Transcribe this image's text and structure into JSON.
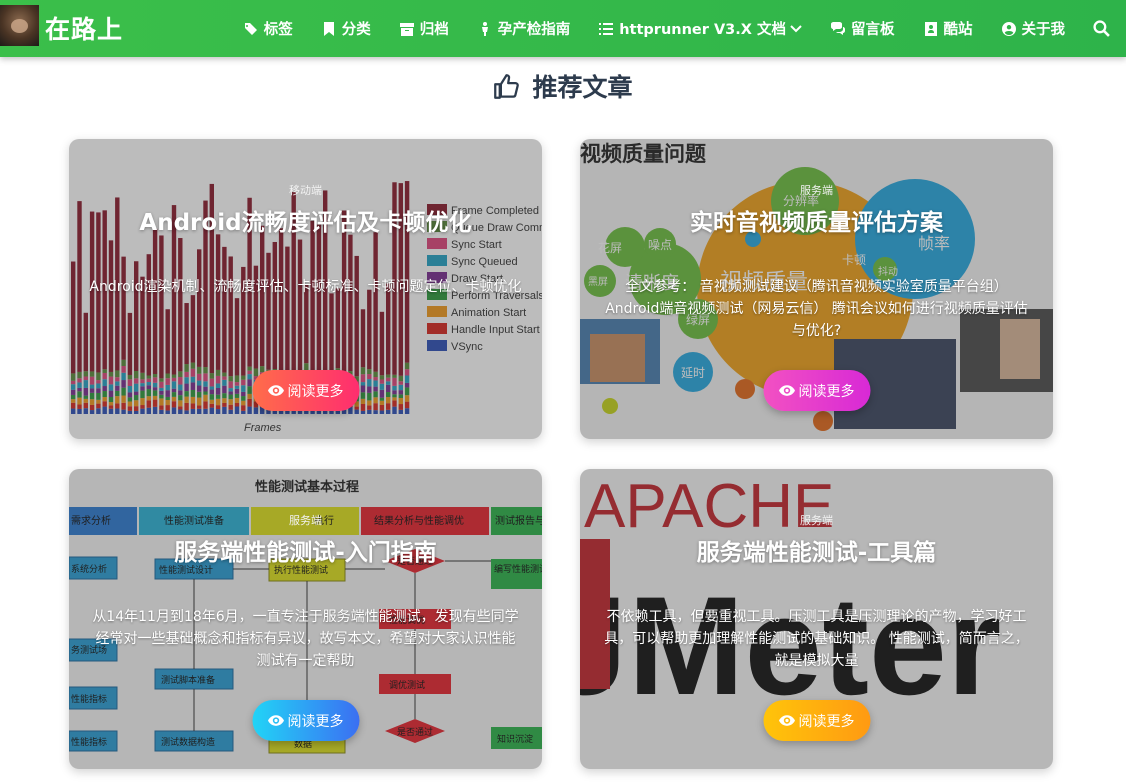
{
  "nav": {
    "brand": "在路上",
    "items": [
      {
        "icon": "tags-icon",
        "label": "标签"
      },
      {
        "icon": "bookmark-icon",
        "label": "分类"
      },
      {
        "icon": "archive-icon",
        "label": "归档"
      },
      {
        "icon": "person-icon",
        "label": "孕产检指南"
      },
      {
        "icon": "list-icon",
        "label": "httprunner V3.X 文档"
      },
      {
        "icon": "comments-icon",
        "label": "留言板"
      },
      {
        "icon": "contact-icon",
        "label": "酷站"
      },
      {
        "icon": "user-circle-icon",
        "label": "关于我"
      }
    ]
  },
  "section": {
    "title": "推荐文章"
  },
  "cards": [
    {
      "category": "移动端",
      "title": "Android流畅度评估及卡顿优化",
      "summary": "Android渲染机制、流畅度评估、卡顿标准、卡顿问题定位、卡顿优化",
      "button": "阅读更多",
      "image_text": {
        "legend": [
          "Frame Completed",
          "Queue Draw Command",
          "Sync Start",
          "Sync Queued",
          "Draw Start",
          "Perform Traversals",
          "Animation Start",
          "Handle Input Start",
          "VSync"
        ],
        "xlabel": "Frames"
      }
    },
    {
      "category": "服务端",
      "title": "实时音视频质量评估方案",
      "summary": "全文参考： 音视频测试建议（腾讯音视频实验室质量平台组） Android端音视频测试（网易云信） 腾讯会议如何进行视频质量评估与优化?",
      "button": "阅读更多",
      "image_text": {
        "heading": "视频质量问题",
        "words": [
          "分辨率",
          "帧率",
          "视频质量",
          "清晰度",
          "花屏",
          "噪点",
          "卡顿",
          "抖动",
          "黑屏",
          "绿屏",
          "延时"
        ]
      }
    },
    {
      "category": "服务端",
      "title": "服务端性能测试-入门指南",
      "summary": "从14年11月到18年6月，一直专注于服务端性能测试，发现有些同学经常对一些基础概念和指标有异议，故写本文，希望对大家认识性能测试有一定帮助",
      "button": "阅读更多",
      "image_text": {
        "heading": "性能测试基本过程",
        "columns": [
          "需求分析",
          "性能测试准备",
          "执行",
          "结果分析与性能调优",
          "测试报告与"
        ],
        "boxes": [
          "系统分析",
          "性能测试设计",
          "执行性能测试",
          "是否通过",
          "编写性能测试报告",
          "测试脚本准备",
          "性能调优",
          "调优测试",
          "是否通过",
          "测试数据构造",
          "数据",
          "性能指标",
          "性能指标",
          "务测试场",
          "知识沉淀"
        ]
      }
    },
    {
      "category": "服务端",
      "title": "服务端性能测试-工具篇",
      "summary": "不依赖工具，但要重视工具。压测工具是压测理论的产物，学习好工具，可以帮助更加理解性能测试的基础知识。 性能测试，简而言之，就是模拟大量",
      "button": "阅读更多",
      "image_text": {
        "brand": "APACHE",
        "logo": "JMeter"
      }
    }
  ],
  "colors": {
    "nav": "#2eb34a",
    "title": "#2d3b4d",
    "btn_red": "#ff4a5d",
    "btn_pink": "#e23ccc",
    "btn_blue": "#2ea1f4",
    "btn_orange": "#ffae10"
  }
}
